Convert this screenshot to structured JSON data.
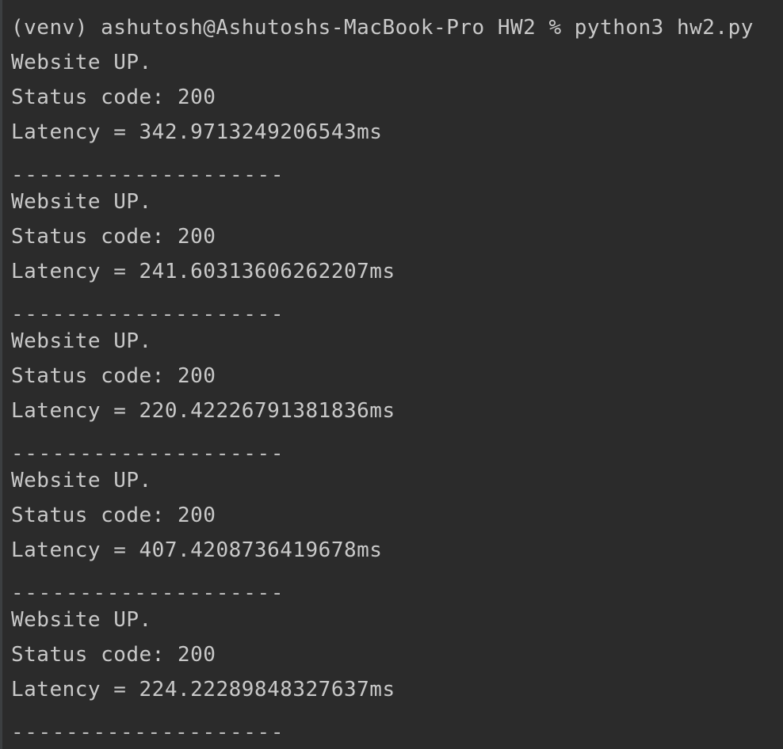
{
  "terminal": {
    "prompt_line": "(venv) ashutosh@Ashutoshs-MacBook-Pro HW2 % python3 hw2.py",
    "separator": "--------------------",
    "blocks": [
      {
        "status": "Website UP.",
        "code": "Status code: 200",
        "latency": "Latency = 342.9713249206543ms"
      },
      {
        "status": "Website UP.",
        "code": "Status code: 200",
        "latency": "Latency = 241.60313606262207ms"
      },
      {
        "status": "Website UP.",
        "code": "Status code: 200",
        "latency": "Latency = 220.42226791381836ms"
      },
      {
        "status": "Website UP.",
        "code": "Status code: 200",
        "latency": "Latency = 407.4208736419678ms"
      },
      {
        "status": "Website UP.",
        "code": "Status code: 200",
        "latency": "Latency = 224.22289848327637ms"
      }
    ]
  },
  "colors": {
    "background": "#2b2b2b",
    "text": "#c9c9c9"
  }
}
